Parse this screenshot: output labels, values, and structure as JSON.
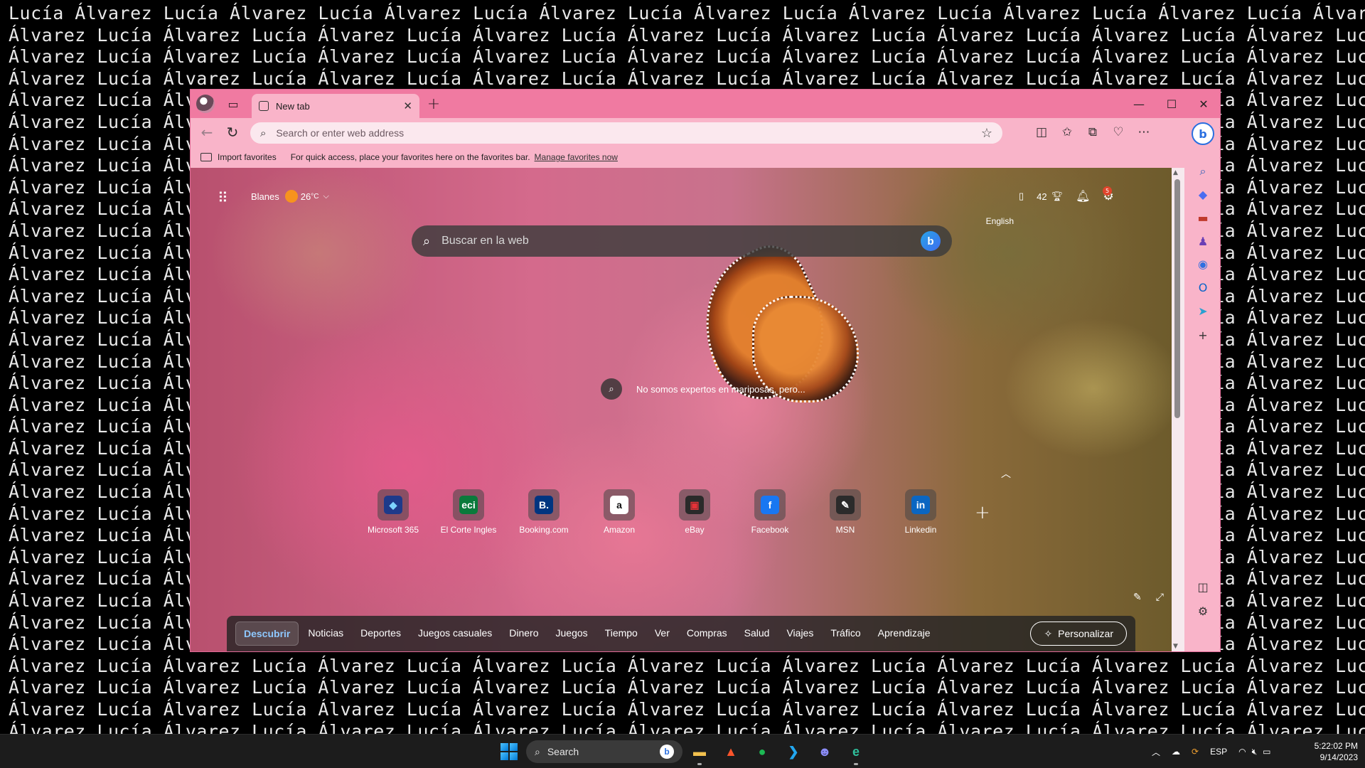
{
  "wallpaper": {
    "name_a": "Lucía",
    "name_b": "Álvarez"
  },
  "browser": {
    "tab": {
      "title": "New tab",
      "close": "✕"
    },
    "new_tab": "+",
    "window_controls": {
      "minimize": "—",
      "maximize": "☐",
      "close": "✕"
    },
    "toolbar": {
      "back": "←",
      "refresh": "↻",
      "address_placeholder": "Search or enter web address",
      "icons": [
        "split-screen-icon",
        "favorites-icon",
        "collections-icon",
        "browser-essentials-icon",
        "more-icon"
      ]
    },
    "favorites_bar": {
      "import": "Import favorites",
      "message": "For quick access, place your favorites here on the favorites bar.",
      "manage_link": "Manage favorites now"
    }
  },
  "newtab": {
    "weather": {
      "city": "Blanes",
      "temp": "26",
      "unit": "°C"
    },
    "rewards_points": "42",
    "notification_count": "5",
    "language": "English",
    "search_placeholder": "Buscar en la web",
    "image_caption": "No somos expertos en mariposas, pero...",
    "quick_links": [
      {
        "label": "Microsoft 365",
        "logo": "◆",
        "bg": "#1e3a8a",
        "fg": "#7dd3fc"
      },
      {
        "label": "El Corte Ingles",
        "logo": "eci",
        "bg": "#0a7a3b",
        "fg": "#ffffff"
      },
      {
        "label": "Booking.com",
        "logo": "B.",
        "bg": "#003580",
        "fg": "#ffffff"
      },
      {
        "label": "Amazon",
        "logo": "a",
        "bg": "#ffffff",
        "fg": "#111111"
      },
      {
        "label": "eBay",
        "logo": "▣",
        "bg": "#2a2a2a",
        "fg": "#e53238"
      },
      {
        "label": "Facebook",
        "logo": "f",
        "bg": "#1877f2",
        "fg": "#ffffff"
      },
      {
        "label": "MSN",
        "logo": "✎",
        "bg": "#2b2b2b",
        "fg": "#ffffff"
      },
      {
        "label": "Linkedin",
        "logo": "in",
        "bg": "#0a66c2",
        "fg": "#ffffff"
      }
    ],
    "feed_tabs": [
      "Descubrir",
      "Noticias",
      "Deportes",
      "Juegos casuales",
      "Dinero",
      "Juegos",
      "Tiempo",
      "Ver",
      "Compras",
      "Salud",
      "Viajes",
      "Tráfico",
      "Aprendizaje"
    ],
    "active_feed_tab": "Descubrir",
    "personalize": "Personalizar"
  },
  "sidebar": {
    "bing": "b",
    "items": [
      {
        "name": "search-icon",
        "glyph": "⌕",
        "color": "#2d5fb8"
      },
      {
        "name": "shopping-tag-icon",
        "glyph": "◆",
        "color": "#4a6cf0"
      },
      {
        "name": "tools-icon",
        "glyph": "▬",
        "color": "#c0392b"
      },
      {
        "name": "games-icon",
        "glyph": "♟",
        "color": "#6a3fb5"
      },
      {
        "name": "microsoft365-icon",
        "glyph": "◉",
        "color": "#2f6fe0"
      },
      {
        "name": "outlook-icon",
        "glyph": "O",
        "color": "#0a64c8"
      },
      {
        "name": "drop-icon",
        "glyph": "➤",
        "color": "#2aa0d0"
      },
      {
        "name": "add-icon",
        "glyph": "+",
        "color": "#333333"
      }
    ]
  },
  "taskbar": {
    "search_label": "Search",
    "apps": [
      {
        "name": "file-explorer-icon",
        "glyph": "▬",
        "color": "#f2c14e"
      },
      {
        "name": "brave-icon",
        "glyph": "▲",
        "color": "#fb542b"
      },
      {
        "name": "spotify-icon",
        "glyph": "●",
        "color": "#1db954"
      },
      {
        "name": "vscode-icon",
        "glyph": "❯",
        "color": "#22a7f0"
      },
      {
        "name": "discord-icon",
        "glyph": "☻",
        "color": "#8b8cf7"
      },
      {
        "name": "edge-icon",
        "glyph": "e",
        "color": "#2fbf9c"
      }
    ],
    "tray": {
      "language": "ESP"
    },
    "time": "5:22:02 PM",
    "date": "9/14/2023"
  }
}
